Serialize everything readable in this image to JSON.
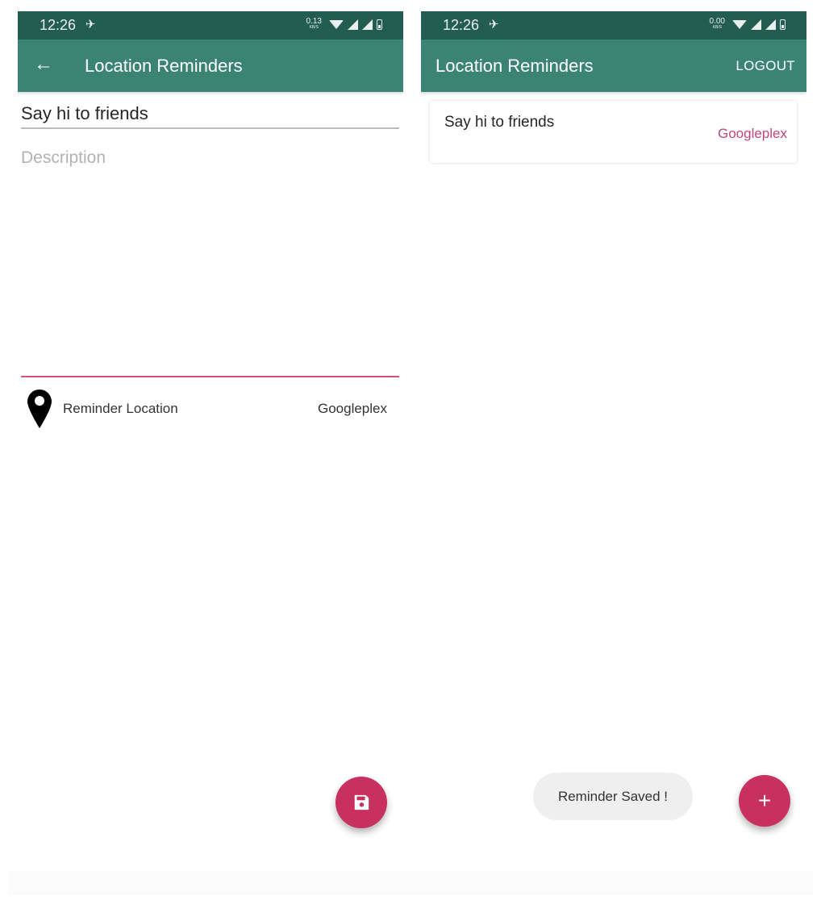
{
  "left_screen": {
    "status_bar": {
      "time": "12:26",
      "net_speed": "0.13",
      "net_unit": "KB/S"
    },
    "app_bar": {
      "title": "Location Reminders",
      "back_icon": "arrow-left-icon"
    },
    "form": {
      "title_value": "Say hi to friends",
      "description_placeholder": "Description",
      "description_value": ""
    },
    "location_row": {
      "label": "Reminder Location",
      "value": "Googleplex",
      "icon": "map-pin-icon"
    },
    "fab": {
      "icon": "save-icon"
    }
  },
  "right_screen": {
    "status_bar": {
      "time": "12:26",
      "net_speed": "0.00",
      "net_unit": "KB/S"
    },
    "app_bar": {
      "title": "Location Reminders",
      "logout_label": "LOGOUT"
    },
    "reminders": [
      {
        "title": "Say hi to friends",
        "location": "Googleplex"
      }
    ],
    "toast": "Reminder Saved !",
    "fab": {
      "icon": "plus-icon",
      "label": "+"
    }
  },
  "colors": {
    "status_bar": "#235c50",
    "app_bar": "#3b8474",
    "accent": "#c8305f",
    "location_text": "#c2447a"
  }
}
